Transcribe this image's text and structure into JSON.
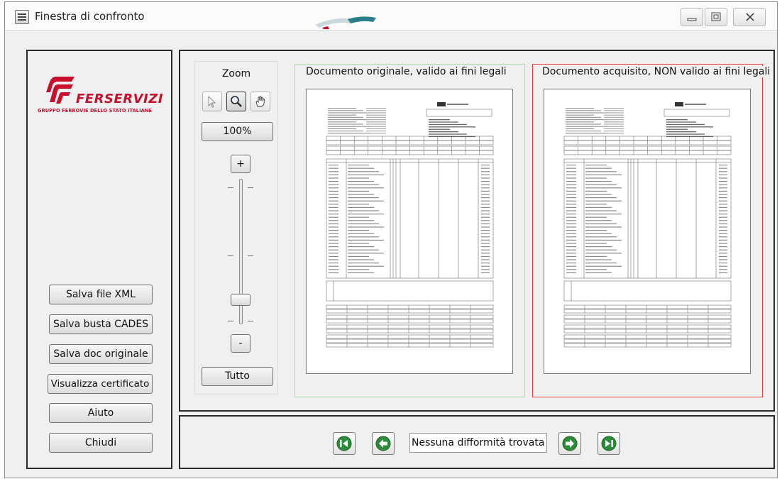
{
  "window": {
    "title": "Finestra di confronto",
    "icon": "document-compare-icon"
  },
  "logo": {
    "name": "FERSERVIZI",
    "subtitle": "GRUPPO FERROVIE DELLO STATO ITALIANE",
    "color": "#c8102e"
  },
  "sidebar": {
    "buttons": [
      {
        "label": "Salva file XML"
      },
      {
        "label": "Salva busta CADES"
      },
      {
        "label": "Salva doc originale"
      },
      {
        "label": "Visualizza certificato"
      },
      {
        "label": "Aiuto"
      },
      {
        "label": "Chiudi"
      }
    ]
  },
  "zoom": {
    "title": "Zoom",
    "tools": [
      "pointer-icon",
      "magnifier-icon",
      "hand-icon"
    ],
    "active_tool": "magnifier-icon",
    "level_label": "100%",
    "plus_label": "+",
    "minus_label": "-",
    "fit_label": "Tutto",
    "slider_level": 0.15
  },
  "documents": {
    "original": {
      "label": "Documento originale, valido ai fini legali",
      "border_color": "#a8dca8"
    },
    "acquired": {
      "label": "Documento acquisito, NON valido ai fini legali",
      "border_color": "#e04040"
    }
  },
  "navigation": {
    "status": "Nessuna difformità trovata",
    "buttons": [
      "first-icon",
      "previous-icon",
      "next-icon",
      "last-icon"
    ],
    "accent": "#2e8b3a"
  }
}
